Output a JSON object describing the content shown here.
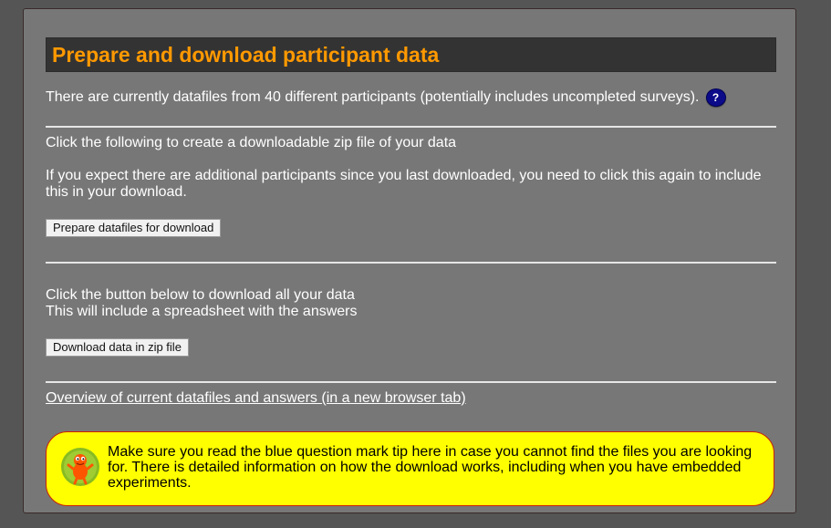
{
  "header": {
    "title": "Prepare and download participant data"
  },
  "status": {
    "participants_text": "There are currently datafiles from 40 different participants (potentially includes uncompleted surveys).",
    "help_icon_label": "?"
  },
  "prepare_section": {
    "intro": "Click the following to create a downloadable zip file of your data",
    "note": "If you expect there are additional participants since you last downloaded, you need to click this again to include this in your download.",
    "button_label": "Prepare datafiles for download"
  },
  "download_section": {
    "line1": "Click the button below to download all your data",
    "line2": "This will include a spreadsheet with the answers",
    "button_label": "Download data in zip file"
  },
  "overview_link": "Overview of current datafiles and answers (in a new browser tab)",
  "tip": {
    "text": "Make sure you read the blue question mark tip here in case you cannot find the files you are looking for. There is detailed information on how the download works, including when you have embedded experiments.",
    "mascot_icon": "orange-creature-icon"
  },
  "colors": {
    "page_background": "#555555",
    "panel_background": "#777777",
    "title_bar": "#333333",
    "title_text": "#ff9900",
    "tip_background": "#ffff00",
    "help_icon": "#0b0b8a"
  }
}
